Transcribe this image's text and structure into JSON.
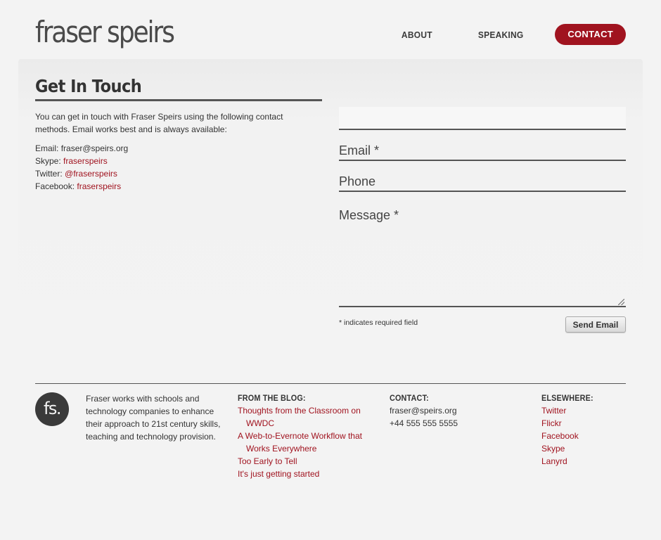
{
  "header": {
    "logo_text": "fraser speirs",
    "nav": [
      {
        "label": "ABOUT"
      },
      {
        "label": "SPEAKING"
      },
      {
        "label": "CONTACT"
      }
    ]
  },
  "main": {
    "title": "Get In Touch",
    "intro": "You can get in touch with Fraser Speirs using the following contact methods. Email works best and is always available:",
    "contacts": {
      "email_label": "Email:",
      "email_value": "fraser@speirs.org",
      "skype_label": "Skype:",
      "skype_value": "fraserspeirs",
      "twitter_label": "Twitter:",
      "twitter_value": "@fraserspeirs",
      "facebook_label": "Facebook:",
      "facebook_value": "fraserspeirs"
    }
  },
  "form": {
    "name_value": "",
    "email_label": "Email *",
    "email_value": "",
    "phone_label": "Phone",
    "phone_value": "",
    "message_label": "Message *",
    "message_value": "",
    "required_note": "* indicates required field",
    "send_label": "Send Email"
  },
  "footer": {
    "logo_text": "fs.",
    "about": "Fraser works with schools and technology companies to enhance their approach to 21st century skills, teaching and technology provision.",
    "blog": {
      "heading": "FROM THE BLOG:",
      "links": [
        "Thoughts from the Classroom on WWDC",
        "A Web-to-Evernote Workflow that Works Everywhere",
        "Too Early to Tell",
        "It's just getting started"
      ]
    },
    "contact": {
      "heading": "CONTACT:",
      "email": "fraser@speirs.org",
      "phone": "+44 555 555 5555"
    },
    "elsewhere": {
      "heading": "ELSEWHERE:",
      "links": [
        "Twitter",
        "Flickr",
        "Facebook",
        "Skype",
        "Lanyrd"
      ]
    }
  },
  "colors": {
    "accent": "#a0131f",
    "text": "#333333",
    "background": "#f3f3f3"
  }
}
